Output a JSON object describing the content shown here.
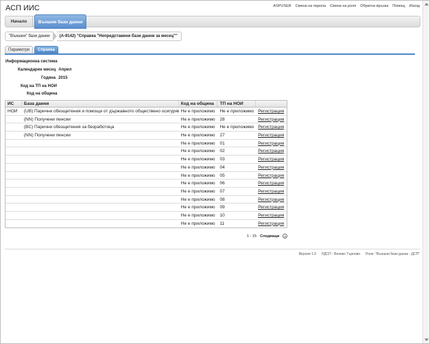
{
  "app": {
    "title": "АСП ИИС"
  },
  "top_links": [
    "ASPUSER",
    "Смяна на парола",
    "Смяна на роля",
    "Обратна връзка",
    "Помощ",
    "Изход"
  ],
  "nav": {
    "home": "Начало",
    "external": "Външни бази данни"
  },
  "breadcrumb": {
    "first": "\"Външни\" бази данни",
    "second": "(А-9142) \"Справка \"Непредставени бази данни за месец\"\""
  },
  "tabs": {
    "params": "Параметри",
    "report": "Справка"
  },
  "params": {
    "system_label": "Информационна система",
    "month_label": "Календарен месец",
    "month_value": "Април",
    "year_label": "Година",
    "year_value": "2015",
    "tp_label": "Код на ТП на НОИ",
    "municipality_label": "Код на община"
  },
  "table": {
    "headers": [
      "ИС",
      "База данни",
      "Код на община",
      "ТП на НОИ",
      ""
    ],
    "rows": [
      [
        "НОИ",
        "(UB) Парични обезщетения и помощи от държавното обществено осигуряване",
        "Не е приложимо",
        "Не е приложимо",
        "Регистрация"
      ],
      [
        "",
        "(NN) Получени пенсии",
        "Не е приложимо",
        "28",
        "Регистрация"
      ],
      [
        "",
        "(BC) Парични обезщетения за безработица",
        "Не е приложимо",
        "Не е приложимо",
        "Регистрация"
      ],
      [
        "",
        "(NN) Получени пенсии",
        "Не е приложимо",
        "27",
        "Регистрация"
      ],
      [
        "",
        "",
        "Не е приложимо",
        "01",
        "Регистрация"
      ],
      [
        "",
        "",
        "Не е приложимо",
        "02",
        "Регистрация"
      ],
      [
        "",
        "",
        "Не е приложимо",
        "03",
        "Регистрация"
      ],
      [
        "",
        "",
        "Не е приложимо",
        "04",
        "Регистрация"
      ],
      [
        "",
        "",
        "Не е приложимо",
        "05",
        "Регистрация"
      ],
      [
        "",
        "",
        "Не е приложимо",
        "06",
        "Регистрация"
      ],
      [
        "",
        "",
        "Не е приложимо",
        "07",
        "Регистрация"
      ],
      [
        "",
        "",
        "Не е приложимо",
        "08",
        "Регистрация"
      ],
      [
        "",
        "",
        "Не е приложимо",
        "09",
        "Регистрация"
      ],
      [
        "",
        "",
        "Не е приложимо",
        "10",
        "Регистрация"
      ],
      [
        "",
        "",
        "Не е приложимо",
        "11",
        "Регистрация"
      ]
    ]
  },
  "pager": {
    "range": "1 - 15",
    "next": "Следващи"
  },
  "footer": [
    "Версия 1.0",
    "РДСП - Велико Търново",
    "Роля: \"Външни бази данни - ДСП\""
  ]
}
